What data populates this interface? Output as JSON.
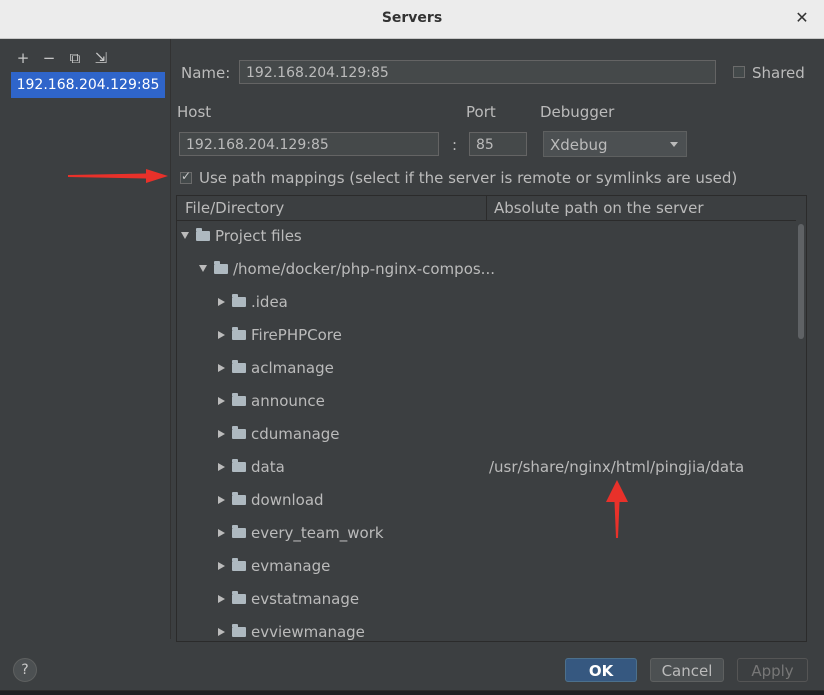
{
  "window": {
    "title": "Servers"
  },
  "sidebar": {
    "tools": [
      {
        "name": "add-icon",
        "glyph": "+"
      },
      {
        "name": "remove-icon",
        "glyph": "−"
      },
      {
        "name": "copy-icon",
        "glyph": "⧉"
      },
      {
        "name": "import-icon",
        "glyph": "⇲"
      }
    ],
    "servers": [
      "192.168.204.129:85"
    ]
  },
  "form": {
    "name_label": "Name:",
    "name_value": "192.168.204.129:85",
    "shared_label": "Shared",
    "host_label": "Host",
    "host_value": "192.168.204.129:85",
    "port_label": "Port",
    "port_sep": ":",
    "port_value": "85",
    "debugger_label": "Debugger",
    "debugger_value": "Xdebug",
    "mappings_label": "Use path mappings (select if the server is remote or symlinks are used)"
  },
  "table": {
    "headers": [
      "File/Directory",
      "Absolute path on the server"
    ],
    "rows": [
      {
        "level": 0,
        "expanded": true,
        "name": "Project files",
        "remote": ""
      },
      {
        "level": 1,
        "expanded": true,
        "name": "/home/docker/php-nginx-compos...",
        "remote": ""
      },
      {
        "level": 2,
        "expanded": false,
        "name": ".idea",
        "remote": ""
      },
      {
        "level": 2,
        "expanded": false,
        "name": "FirePHPCore",
        "remote": ""
      },
      {
        "level": 2,
        "expanded": false,
        "name": "aclmanage",
        "remote": ""
      },
      {
        "level": 2,
        "expanded": false,
        "name": "announce",
        "remote": ""
      },
      {
        "level": 2,
        "expanded": false,
        "name": "cdumanage",
        "remote": ""
      },
      {
        "level": 2,
        "expanded": false,
        "name": "data",
        "remote": "/usr/share/nginx/html/pingjia/data"
      },
      {
        "level": 2,
        "expanded": false,
        "name": "download",
        "remote": ""
      },
      {
        "level": 2,
        "expanded": false,
        "name": "every_team_work",
        "remote": ""
      },
      {
        "level": 2,
        "expanded": false,
        "name": "evmanage",
        "remote": ""
      },
      {
        "level": 2,
        "expanded": false,
        "name": "evstatmanage",
        "remote": ""
      },
      {
        "level": 2,
        "expanded": false,
        "name": "evviewmanage",
        "remote": ""
      }
    ]
  },
  "buttons": {
    "ok": "OK",
    "cancel": "Cancel",
    "apply": "Apply",
    "help": "?"
  },
  "colors": {
    "accent": "#2f65ca",
    "annotation": "#e8312a",
    "background": "#3c3f41"
  }
}
